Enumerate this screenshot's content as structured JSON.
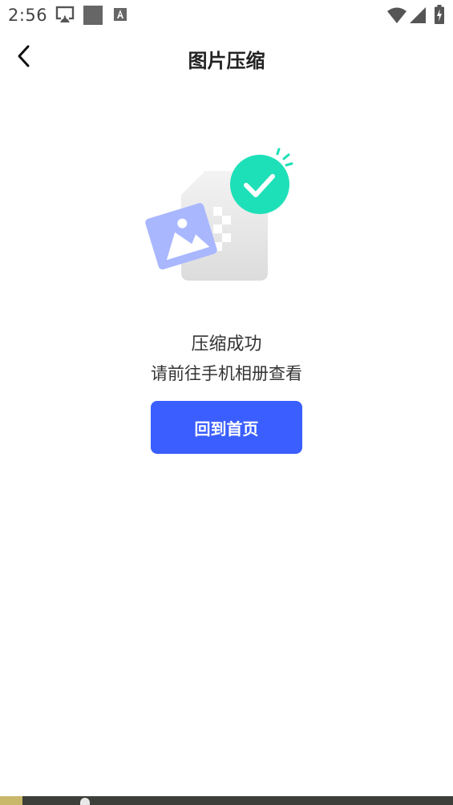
{
  "status_bar": {
    "time": "2:56",
    "left_icons": [
      "cast-icon",
      "square-icon",
      "font-a-icon"
    ],
    "right_icons": [
      "wifi-icon",
      "signal-icon",
      "battery-icon"
    ]
  },
  "header": {
    "back_icon": "chevron-left-icon",
    "title": "图片压缩"
  },
  "illustration": {
    "icons": [
      "compressed-file-icon",
      "image-icon",
      "check-circle-icon"
    ],
    "colors": {
      "check_green": "#1ee0b8",
      "image_blue": "#a9b7ff",
      "file_gray": "#e4e4e4"
    }
  },
  "result": {
    "title": "压缩成功",
    "subtitle": "请前往手机相册查看"
  },
  "actions": {
    "home_label": "回到首页"
  },
  "theme": {
    "accent": "#3a5eff"
  }
}
